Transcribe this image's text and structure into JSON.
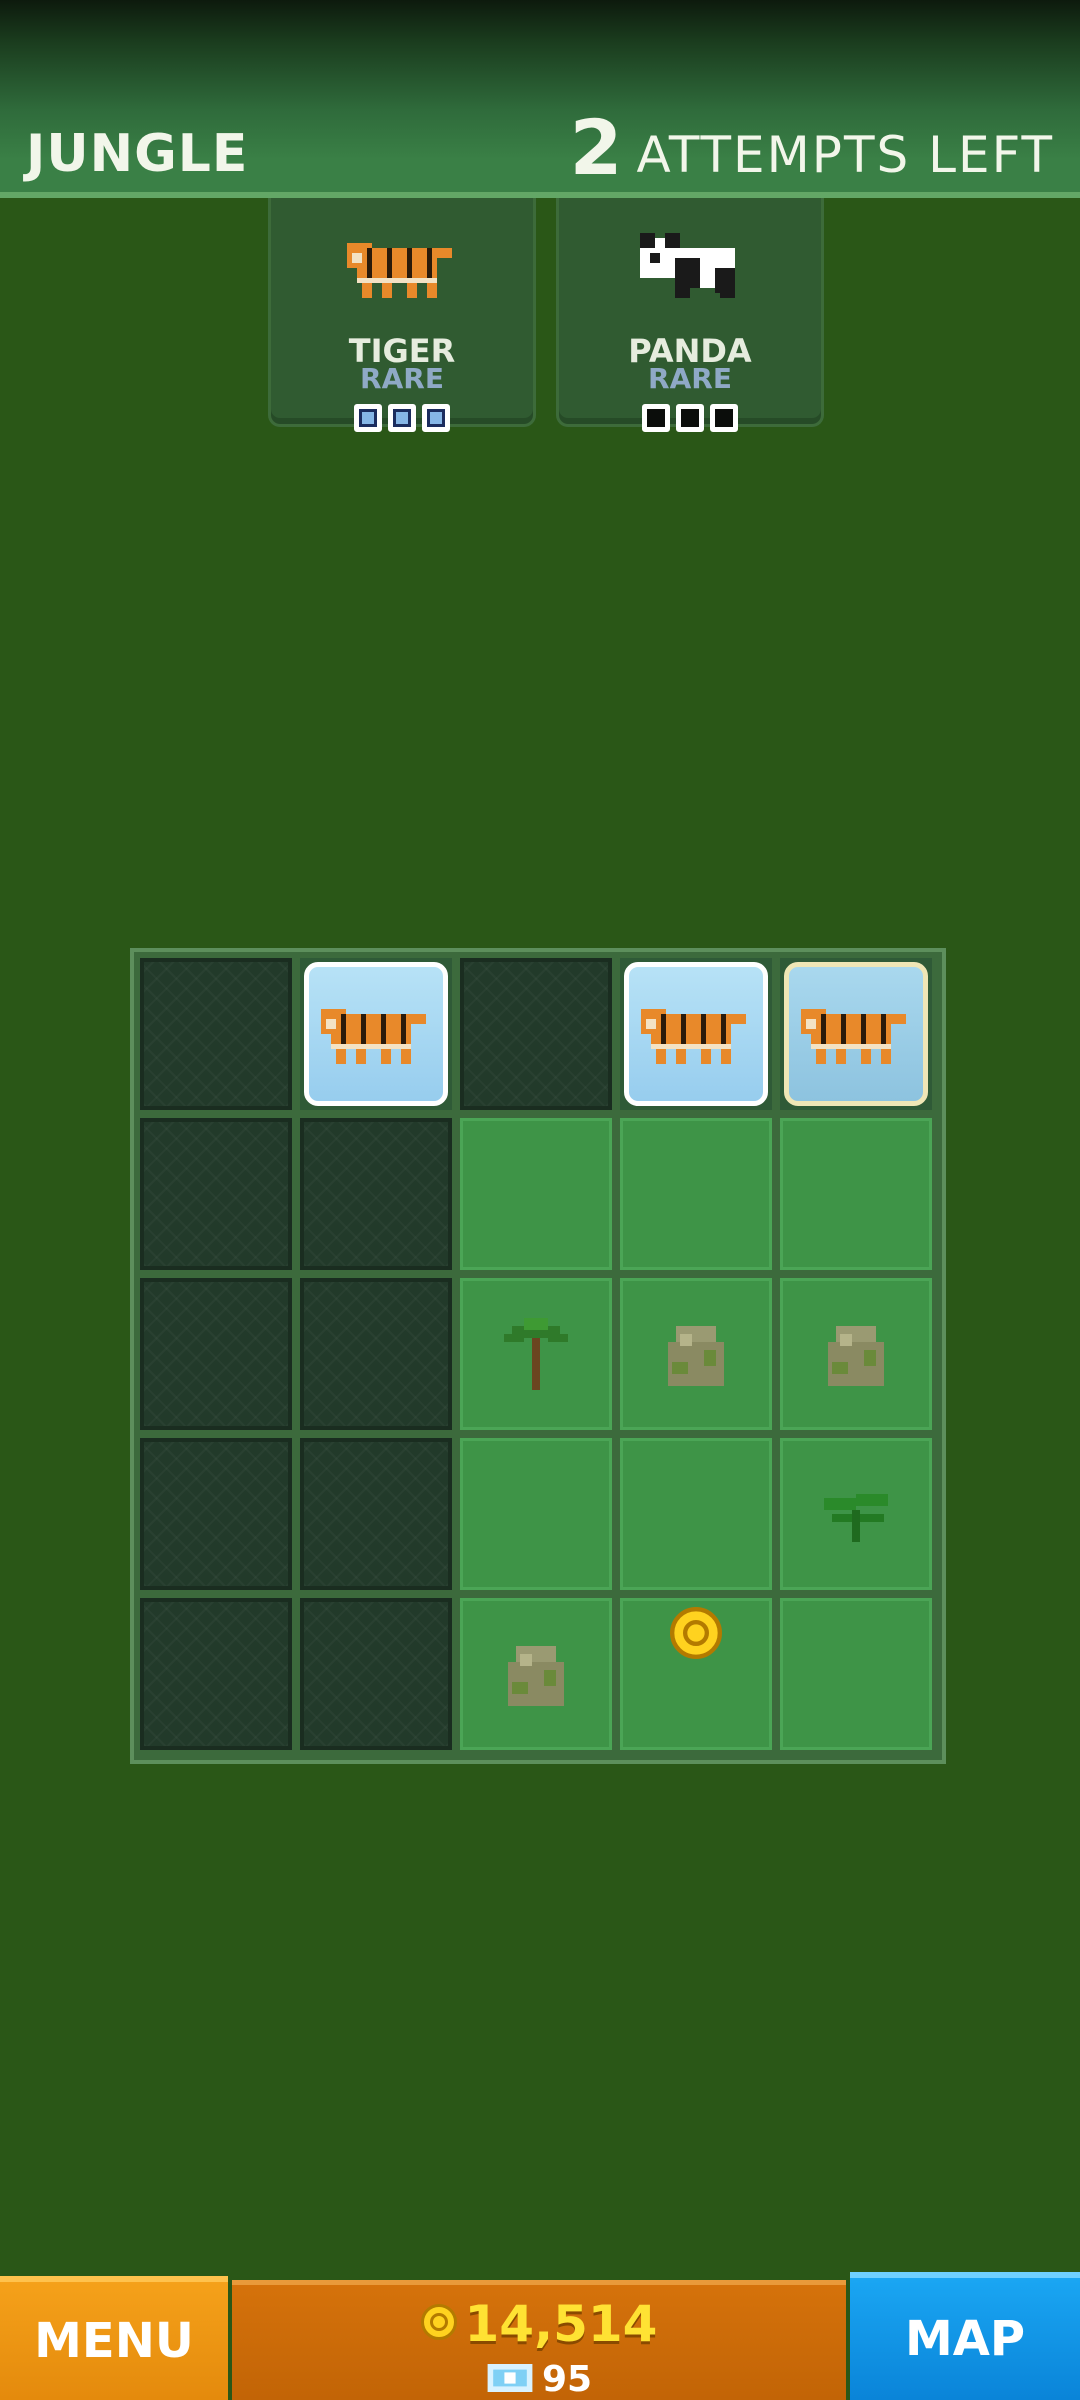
{
  "header": {
    "zone": "JUNGLE",
    "attempts_count": "2",
    "attempts_label": "ATTEMPTS LEFT"
  },
  "cards": [
    {
      "name": "TIGER",
      "rarity": "RARE",
      "icon": "tiger-icon",
      "progress": {
        "filled": 3,
        "total": 3
      }
    },
    {
      "name": "PANDA",
      "rarity": "RARE",
      "icon": "panda-icon",
      "progress": {
        "filled": 0,
        "total": 3
      }
    }
  ],
  "board": {
    "rows": 5,
    "cols": 5,
    "cells": [
      [
        "dark",
        "tiger",
        "dark",
        "tiger",
        "tiger-gold"
      ],
      [
        "dark",
        "dark",
        "grass",
        "grass",
        "grass"
      ],
      [
        "dark",
        "dark",
        "palm",
        "rock",
        "rock"
      ],
      [
        "dark",
        "dark",
        "grass",
        "grass",
        "fern"
      ],
      [
        "dark",
        "dark",
        "rock",
        "coin",
        "grass"
      ]
    ]
  },
  "footer": {
    "menu_label": "MENU",
    "coins": "14,514",
    "gems": "95",
    "map_label": "MAP"
  },
  "colors": {
    "background": "#2a5717",
    "menu": "#f09a14",
    "currency": "#cc6b08",
    "map": "#1196e6",
    "coin_text": "#ffe233"
  }
}
